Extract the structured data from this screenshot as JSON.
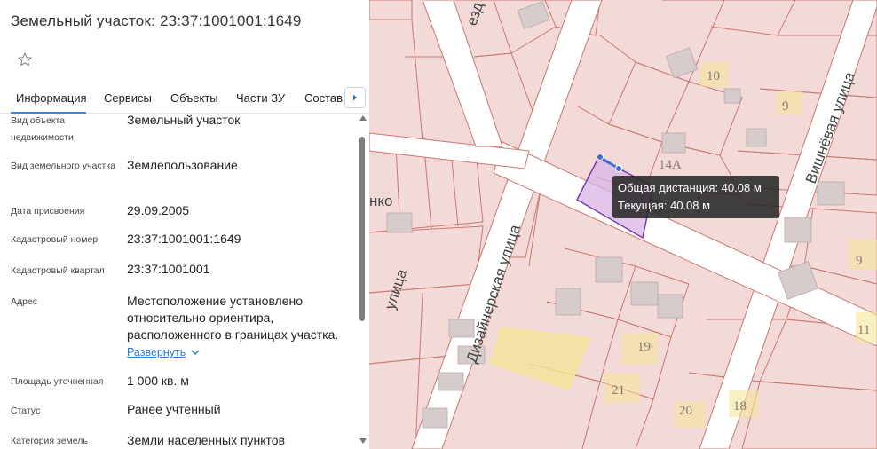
{
  "panel": {
    "title": "Земельный участок: 23:37:1001001:1649",
    "tabs": [
      "Информация",
      "Сервисы",
      "Объекты",
      "Части ЗУ",
      "Состав"
    ],
    "fields": [
      {
        "label": "Вид объекта недвижимости",
        "value": "Земельный участок"
      },
      {
        "label": "Вид земельного участка",
        "value": "Землепользование"
      },
      {
        "label": "Дата присвоения",
        "value": "29.09.2005"
      },
      {
        "label": "Кадастровый номер",
        "value": "23:37:1001001:1649"
      },
      {
        "label": "Кадастровый квартал",
        "value": "23:37:1001001"
      },
      {
        "label": "Адрес",
        "value": "Местоположение установлено относительно ориентира, расположенного в границах участка."
      },
      {
        "label": "Площадь уточненная",
        "value": "1 000 кв. м"
      },
      {
        "label": "Статус",
        "value": "Ранее учтенный"
      },
      {
        "label": "Категория земель",
        "value": "Земли населенных пунктов"
      }
    ],
    "expand_label": "Развернуть"
  },
  "map": {
    "street_labels": [
      "Дизайнерская улица",
      "Вишнёвая улица",
      "улица",
      "нко",
      "езд"
    ],
    "house_numbers": [
      "10",
      "9",
      "14А",
      "9",
      "11",
      "19",
      "21",
      "20",
      "18"
    ],
    "tooltip": {
      "total": "Общая дистанция: 40.08 м",
      "current": "Текущая: 40.08 м"
    }
  },
  "colors": {
    "accent": "#3a86d9",
    "parcel_fill": "#f4d9d9",
    "parcel_line": "#c9776f",
    "road": "#ffffff",
    "building": "#d6cccc",
    "highlight_fill": "#d9b3e6",
    "highlight_line": "#7a3aa8",
    "yellow_zone": "#f2e49a"
  },
  "icons": [
    "star-icon",
    "chevron-right-icon",
    "chevron-down-icon"
  ]
}
